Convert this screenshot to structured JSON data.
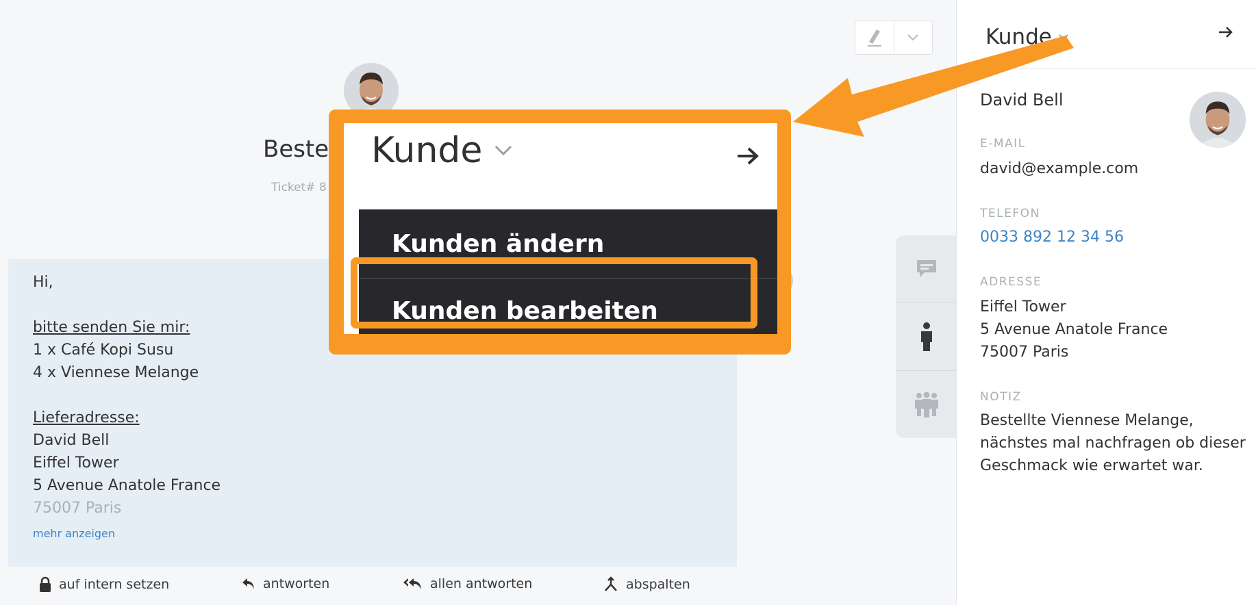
{
  "ticket": {
    "title": "Beste",
    "number": "Ticket# 8"
  },
  "article": {
    "lines": [
      {
        "text": "Hi,",
        "style": ""
      },
      {
        "text": "",
        "style": ""
      },
      {
        "text": "bitte senden Sie mir:",
        "style": "u"
      },
      {
        "text": "1 x Café Kopi Susu",
        "style": ""
      },
      {
        "text": "4 x Viennese Melange",
        "style": ""
      },
      {
        "text": "",
        "style": ""
      },
      {
        "text": "Lieferadresse:",
        "style": "u"
      },
      {
        "text": "David Bell",
        "style": ""
      },
      {
        "text": "Eiffel Tower",
        "style": ""
      },
      {
        "text": "5 Avenue Anatole France",
        "style": ""
      },
      {
        "text": "75007 Paris",
        "style": "fade"
      }
    ],
    "more_link": "mehr anzeigen"
  },
  "actions": {
    "internal": "auf intern setzen",
    "reply": "antworten",
    "reply_all": "allen antworten",
    "split": "abspalten"
  },
  "sidebar": {
    "title": "Kunde",
    "customer_name": "David Bell",
    "email_label": "E-MAIL",
    "email": "david@example.com",
    "phone_label": "TELEFON",
    "phone": "0033 892 12 34 56",
    "address_label": "ADRESSE",
    "address_lines": [
      "Eiffel Tower",
      "5 Avenue Anatole France",
      "75007 Paris"
    ],
    "note_label": "NOTIZ",
    "note_lines": [
      "Bestellte Viennese Melange,",
      "nächstes mal nachfragen ob dieser",
      "Geschmack wie erwartet war."
    ]
  },
  "popup": {
    "title": "Kunde",
    "menu": [
      "Kunden ändern",
      "Kunden bearbeiten"
    ]
  },
  "colors": {
    "highlight": "#f89925",
    "menu_bg": "#28282c",
    "link": "#3b85c6"
  },
  "icons": [
    "pen-icon",
    "chevron-down-icon",
    "arrow-right-icon",
    "chat-icon",
    "person-icon",
    "group-icon",
    "lock-icon",
    "reply-icon",
    "reply-all-icon",
    "split-icon"
  ]
}
